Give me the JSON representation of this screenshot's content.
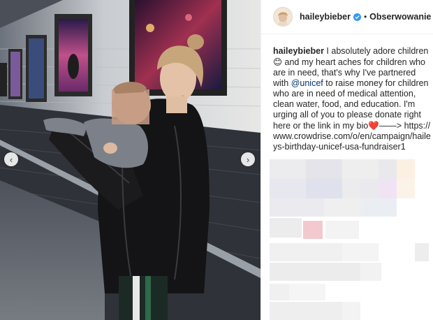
{
  "post": {
    "username": "haileybieber",
    "follow_label": "Obserwowanie",
    "separator": "•",
    "caption": {
      "username": "haileybieber",
      "text_1": " I absolutely adore children ",
      "emoji_smile": "😊",
      "text_2": " and my heart aches for children who are in need, that's why I've partnered with ",
      "mention": "@unicef",
      "text_3": " to raise money for children who are in need of medical attention, clean water, food, and education. I'm urging all of you to please donate right here or the link in my bio",
      "emoji_heart": "❤️",
      "arrow": "——>",
      "url": "https://www.crowdrise.com/o/en/campaign/haileys-birthday-unicef-usa-fundraiser1"
    }
  },
  "carousel": {
    "prev_icon": "‹",
    "next_icon": "›"
  },
  "colors": {
    "mention": "#003569",
    "verified": "#3897f0",
    "text": "#262626"
  },
  "icons": {
    "verified": "verified-badge-icon",
    "prev": "chevron-left-icon",
    "next": "chevron-right-icon"
  }
}
